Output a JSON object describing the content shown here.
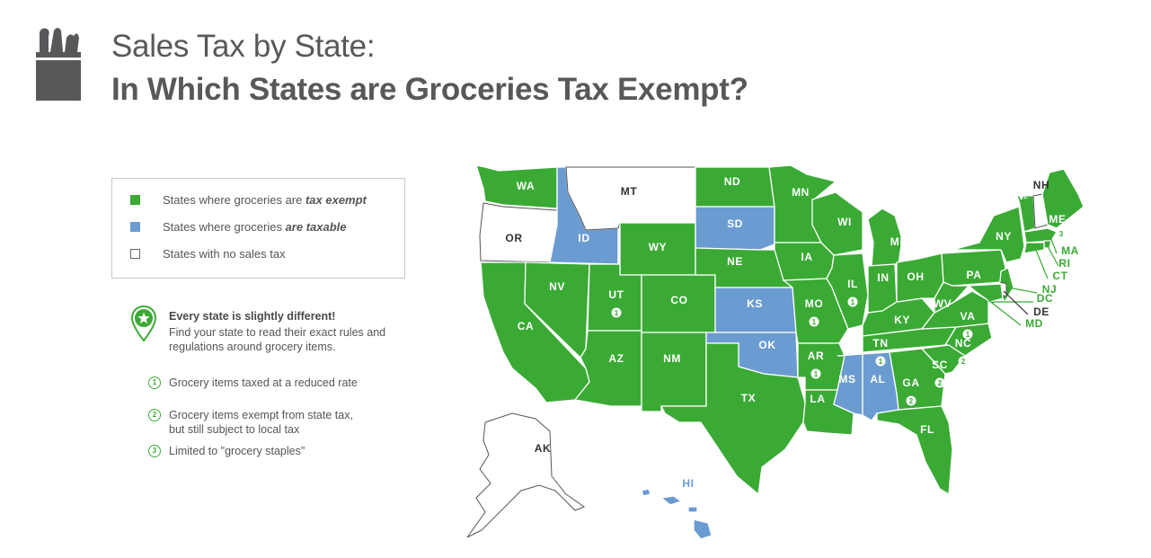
{
  "title": {
    "line1": "Sales Tax by State:",
    "line2": "In Which States are Groceries Tax Exempt?"
  },
  "colors": {
    "exempt": "#3aaa35",
    "taxable": "#6a9bd1",
    "no_tax": "#ffffff",
    "title": "#58585b"
  },
  "legend": [
    {
      "prefix": "States where groceries are ",
      "emph": "tax exempt",
      "color": "#3aaa35",
      "key": "exempt"
    },
    {
      "prefix": "States where groceries ",
      "emph": "are taxable",
      "color": "#6a9bd1",
      "key": "taxable"
    },
    {
      "prefix": "States with no sales tax",
      "emph": "",
      "color": "#ffffff",
      "key": "no_tax"
    }
  ],
  "note": {
    "title": "Every state is slightly different!",
    "body": "Find your state to read their exact rules and regulations around grocery items.",
    "icon": "star-pin-icon"
  },
  "footnotes": [
    {
      "num": "1",
      "text": "Grocery items taxed at a reduced rate"
    },
    {
      "num": "2",
      "text": "Grocery items exempt from state tax, but still subject to local tax"
    },
    {
      "num": "3",
      "text": "Limited to \"grocery staples\""
    }
  ],
  "states": [
    {
      "abbr": "WA",
      "category": "exempt"
    },
    {
      "abbr": "OR",
      "category": "no_tax"
    },
    {
      "abbr": "CA",
      "category": "exempt"
    },
    {
      "abbr": "ID",
      "category": "taxable"
    },
    {
      "abbr": "NV",
      "category": "exempt"
    },
    {
      "abbr": "MT",
      "category": "no_tax"
    },
    {
      "abbr": "WY",
      "category": "exempt"
    },
    {
      "abbr": "UT",
      "category": "exempt",
      "note": "1"
    },
    {
      "abbr": "AZ",
      "category": "exempt"
    },
    {
      "abbr": "CO",
      "category": "exempt"
    },
    {
      "abbr": "NM",
      "category": "exempt"
    },
    {
      "abbr": "ND",
      "category": "exempt"
    },
    {
      "abbr": "SD",
      "category": "taxable"
    },
    {
      "abbr": "NE",
      "category": "exempt"
    },
    {
      "abbr": "KS",
      "category": "taxable"
    },
    {
      "abbr": "OK",
      "category": "taxable"
    },
    {
      "abbr": "TX",
      "category": "exempt"
    },
    {
      "abbr": "MN",
      "category": "exempt"
    },
    {
      "abbr": "IA",
      "category": "exempt"
    },
    {
      "abbr": "MO",
      "category": "exempt",
      "note": "1"
    },
    {
      "abbr": "AR",
      "category": "exempt",
      "note": "1"
    },
    {
      "abbr": "LA",
      "category": "exempt"
    },
    {
      "abbr": "WI",
      "category": "exempt"
    },
    {
      "abbr": "IL",
      "category": "exempt",
      "note": "1"
    },
    {
      "abbr": "MS",
      "category": "taxable"
    },
    {
      "abbr": "MI",
      "category": "exempt"
    },
    {
      "abbr": "IN",
      "category": "exempt"
    },
    {
      "abbr": "KY",
      "category": "exempt"
    },
    {
      "abbr": "TN",
      "category": "exempt",
      "note": "1"
    },
    {
      "abbr": "AL",
      "category": "taxable"
    },
    {
      "abbr": "OH",
      "category": "exempt"
    },
    {
      "abbr": "GA",
      "category": "exempt",
      "note": "2"
    },
    {
      "abbr": "FL",
      "category": "exempt"
    },
    {
      "abbr": "SC",
      "category": "exempt",
      "note": "2"
    },
    {
      "abbr": "NC",
      "category": "exempt",
      "note": "2"
    },
    {
      "abbr": "VA",
      "category": "exempt",
      "note": "1"
    },
    {
      "abbr": "WV",
      "category": "exempt"
    },
    {
      "abbr": "PA",
      "category": "exempt"
    },
    {
      "abbr": "NY",
      "category": "exempt"
    },
    {
      "abbr": "VT",
      "category": "exempt"
    },
    {
      "abbr": "NH",
      "category": "no_tax"
    },
    {
      "abbr": "ME",
      "category": "exempt",
      "note": "3"
    },
    {
      "abbr": "MA",
      "category": "exempt"
    },
    {
      "abbr": "RI",
      "category": "exempt"
    },
    {
      "abbr": "CT",
      "category": "exempt"
    },
    {
      "abbr": "NJ",
      "category": "exempt"
    },
    {
      "abbr": "DC",
      "category": "exempt"
    },
    {
      "abbr": "DE",
      "category": "no_tax"
    },
    {
      "abbr": "MD",
      "category": "exempt"
    },
    {
      "abbr": "AK",
      "category": "no_tax"
    },
    {
      "abbr": "HI",
      "category": "taxable"
    }
  ]
}
